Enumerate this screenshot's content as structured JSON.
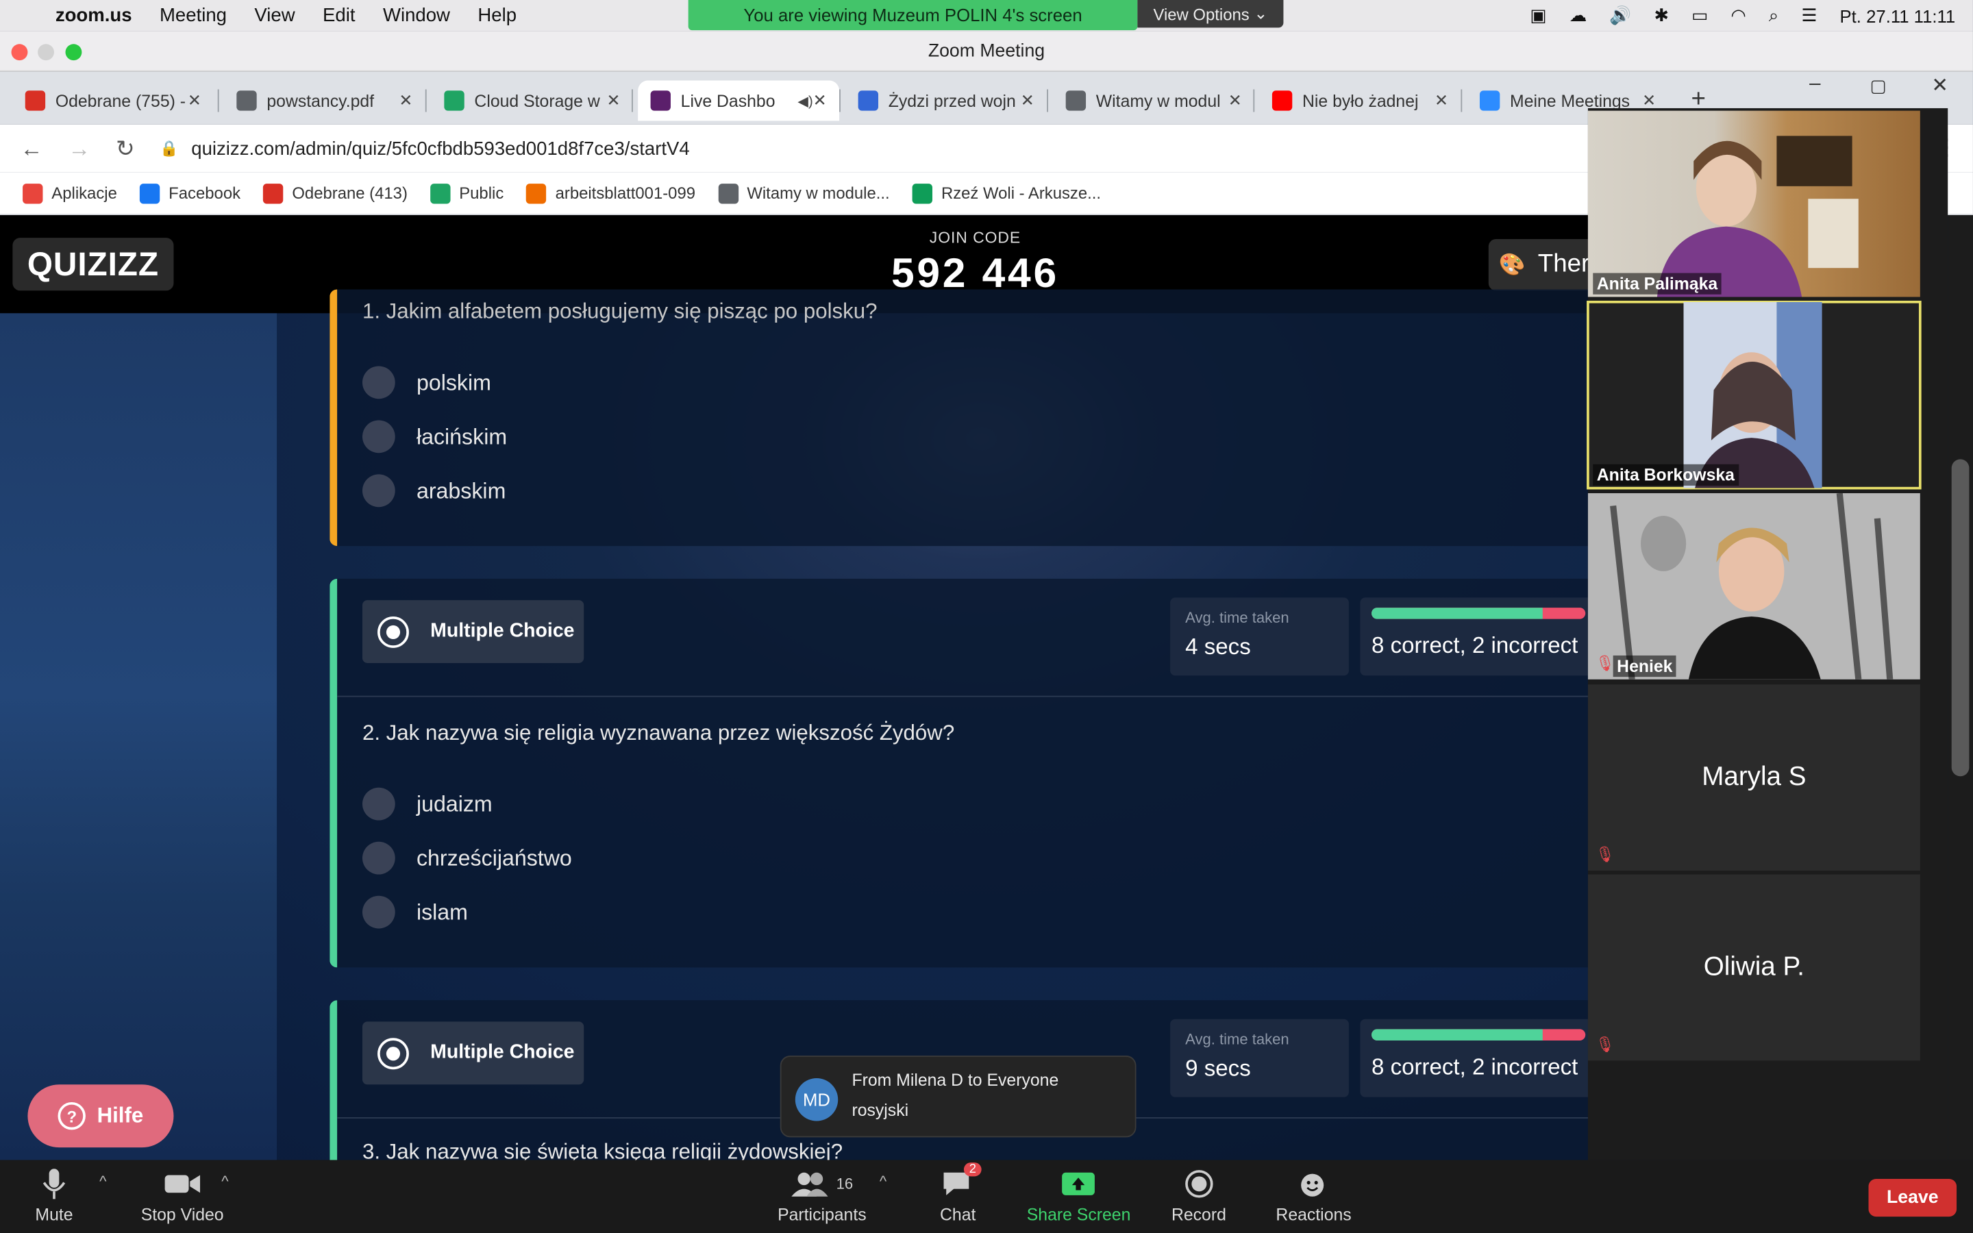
{
  "menubar": {
    "app": "zoom.us",
    "items": [
      "Meeting",
      "View",
      "Edit",
      "Window",
      "Help"
    ],
    "datetime": "Pt. 27.11  11:11"
  },
  "share_banner": {
    "text": "You are viewing Muzeum POLIN 4's screen",
    "view_options": "View Options"
  },
  "zoom_window": {
    "title": "Zoom Meeting"
  },
  "browser": {
    "tabs": [
      {
        "title": "Odebrane (755) -",
        "icon": "gmail-icon",
        "color": "#d93025"
      },
      {
        "title": "powstancy.pdf",
        "icon": "globe-icon",
        "color": "#5f6368"
      },
      {
        "title": "Cloud Storage w",
        "icon": "drive-icon",
        "color": "#1fa463"
      },
      {
        "title": "Live Dashbo",
        "icon": "quizizz-icon",
        "color": "#5b1f6b",
        "active": true
      },
      {
        "title": "Żydzi przed wojn",
        "icon": "slides-icon",
        "color": "#3367d6"
      },
      {
        "title": "Witamy w modul",
        "icon": "globe-icon",
        "color": "#5f6368"
      },
      {
        "title": "Nie było żadnej",
        "icon": "youtube-icon",
        "color": "#ff0000"
      },
      {
        "title": "Meine Meetings",
        "icon": "zoom-icon",
        "color": "#2d8cff"
      }
    ],
    "url": "quizizz.com/admin/quiz/5fc0cfbdb593ed001d8f7ce3/startV4",
    "bookmarks": [
      {
        "label": "Aplikacje",
        "icon": "apps-icon",
        "color": "#e8453c"
      },
      {
        "label": "Facebook",
        "icon": "facebook-icon",
        "color": "#1877f2"
      },
      {
        "label": "Odebrane (413)",
        "icon": "gmail-icon",
        "color": "#d93025"
      },
      {
        "label": "Public",
        "icon": "drive-icon",
        "color": "#1fa463"
      },
      {
        "label": "arbeitsblatt001-099",
        "icon": "s-icon",
        "color": "#ef6c00"
      },
      {
        "label": "Witamy w module...",
        "icon": "globe-icon",
        "color": "#5f6368"
      },
      {
        "label": "Rzeź Woli - Arkusze...",
        "icon": "sheets-icon",
        "color": "#0f9d58"
      }
    ]
  },
  "quizizz": {
    "logo": "QUIZIZZ",
    "join_label": "JOIN CODE",
    "join_code": "592 446",
    "theme_label": "Ther",
    "questions": [
      {
        "text": "1. Jakim alfabetem posługujemy się pisząc po polsku?",
        "options": [
          "polskim",
          "łacińskim",
          "arabskim"
        ]
      },
      {
        "type": "Multiple Choice",
        "avg_label": "Avg. time taken",
        "avg": "4 secs",
        "result": "8 correct, 2 incorrect",
        "correct_ratio": 0.8,
        "text": "2. Jak nazywa się religia wyznawana przez większość Żydów?",
        "options": [
          "judaizm",
          "chrześcijaństwo",
          "islam"
        ]
      },
      {
        "type": "Multiple Choice",
        "avg_label": "Avg. time taken",
        "avg": "9 secs",
        "result": "8 correct, 2 incorrect",
        "correct_ratio": 0.8,
        "text": "3. Jak nazywa się święta księga religii żydowskiej?"
      }
    ],
    "help": "Hilfe"
  },
  "participants_gallery": [
    {
      "name": "Anita Palimąka",
      "video": true
    },
    {
      "name": "Anita Borkowska",
      "video": true,
      "speaking": true
    },
    {
      "name": "Heniek",
      "video": true,
      "muted": true
    },
    {
      "name": "Maryla S",
      "video": false,
      "muted": true
    },
    {
      "name": "Oliwia P.",
      "video": false,
      "muted": true
    }
  ],
  "chat_toast": {
    "initials": "MD",
    "from": "From Milena D to Everyone",
    "message": "rosyjski"
  },
  "toolbar": {
    "mute": "Mute",
    "stop_video": "Stop Video",
    "participants": "Participants",
    "participants_count": "16",
    "chat": "Chat",
    "chat_badge": "2",
    "share": "Share Screen",
    "record": "Record",
    "reactions": "Reactions",
    "leave": "Leave"
  }
}
